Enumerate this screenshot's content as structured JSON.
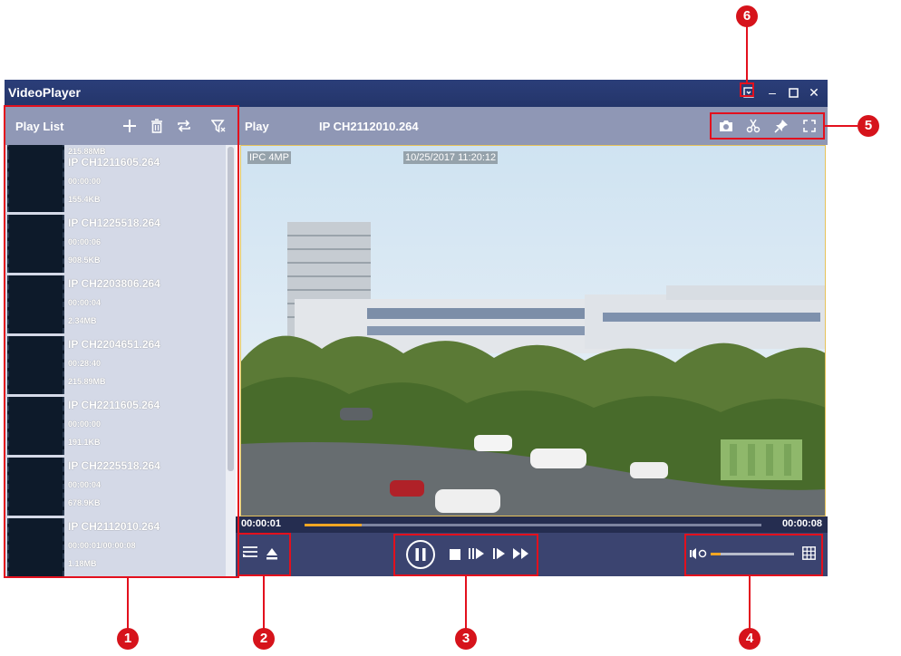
{
  "window": {
    "title": "VideoPlayer"
  },
  "playlist": {
    "title": "Play List",
    "items": [
      {
        "name": "",
        "time": "",
        "size": "215.88MB"
      },
      {
        "name": "IP CH1211605.264",
        "time": "00:00:00",
        "size": "155.4KB"
      },
      {
        "name": "IP CH1225518.264",
        "time": "00:00:06",
        "size": "908.5KB"
      },
      {
        "name": "IP CH2203806.264",
        "time": "00:00:04",
        "size": "2.34MB"
      },
      {
        "name": "IP CH2204651.264",
        "time": "00:28:40",
        "size": "215.89MB"
      },
      {
        "name": "IP CH2211605.264",
        "time": "00:00:00",
        "size": "191.1KB"
      },
      {
        "name": "IP CH2225518.264",
        "time": "00:00:04",
        "size": "678.9KB"
      },
      {
        "name": "IP CH2112010.264",
        "time": "00:00:01/00:00:08",
        "size": "1.18MB"
      }
    ]
  },
  "main": {
    "play_label": "Play",
    "file_name": "IP CH2112010.264",
    "overlay_camera": "IPC 4MP",
    "overlay_timestamp": "10/25/2017 11:20:12",
    "current_time": "00:00:01",
    "total_time": "00:00:08",
    "progress": 0.125,
    "volume": 0.12
  },
  "icons": {
    "playlist_add": "plus-icon",
    "playlist_delete": "trash-icon",
    "playlist_loop": "loop-icon",
    "playlist_filter": "filter-icon",
    "snapshot": "camera-icon",
    "clip": "scissors-icon",
    "pin": "pin-icon",
    "fullscreen": "fullscreen-icon"
  },
  "callouts": [
    "1",
    "2",
    "3",
    "4",
    "5",
    "6"
  ],
  "colors": {
    "accent": "#f5a623",
    "titlebar": "#24356a",
    "header": "#8f97b5",
    "callout": "#d6131b"
  }
}
